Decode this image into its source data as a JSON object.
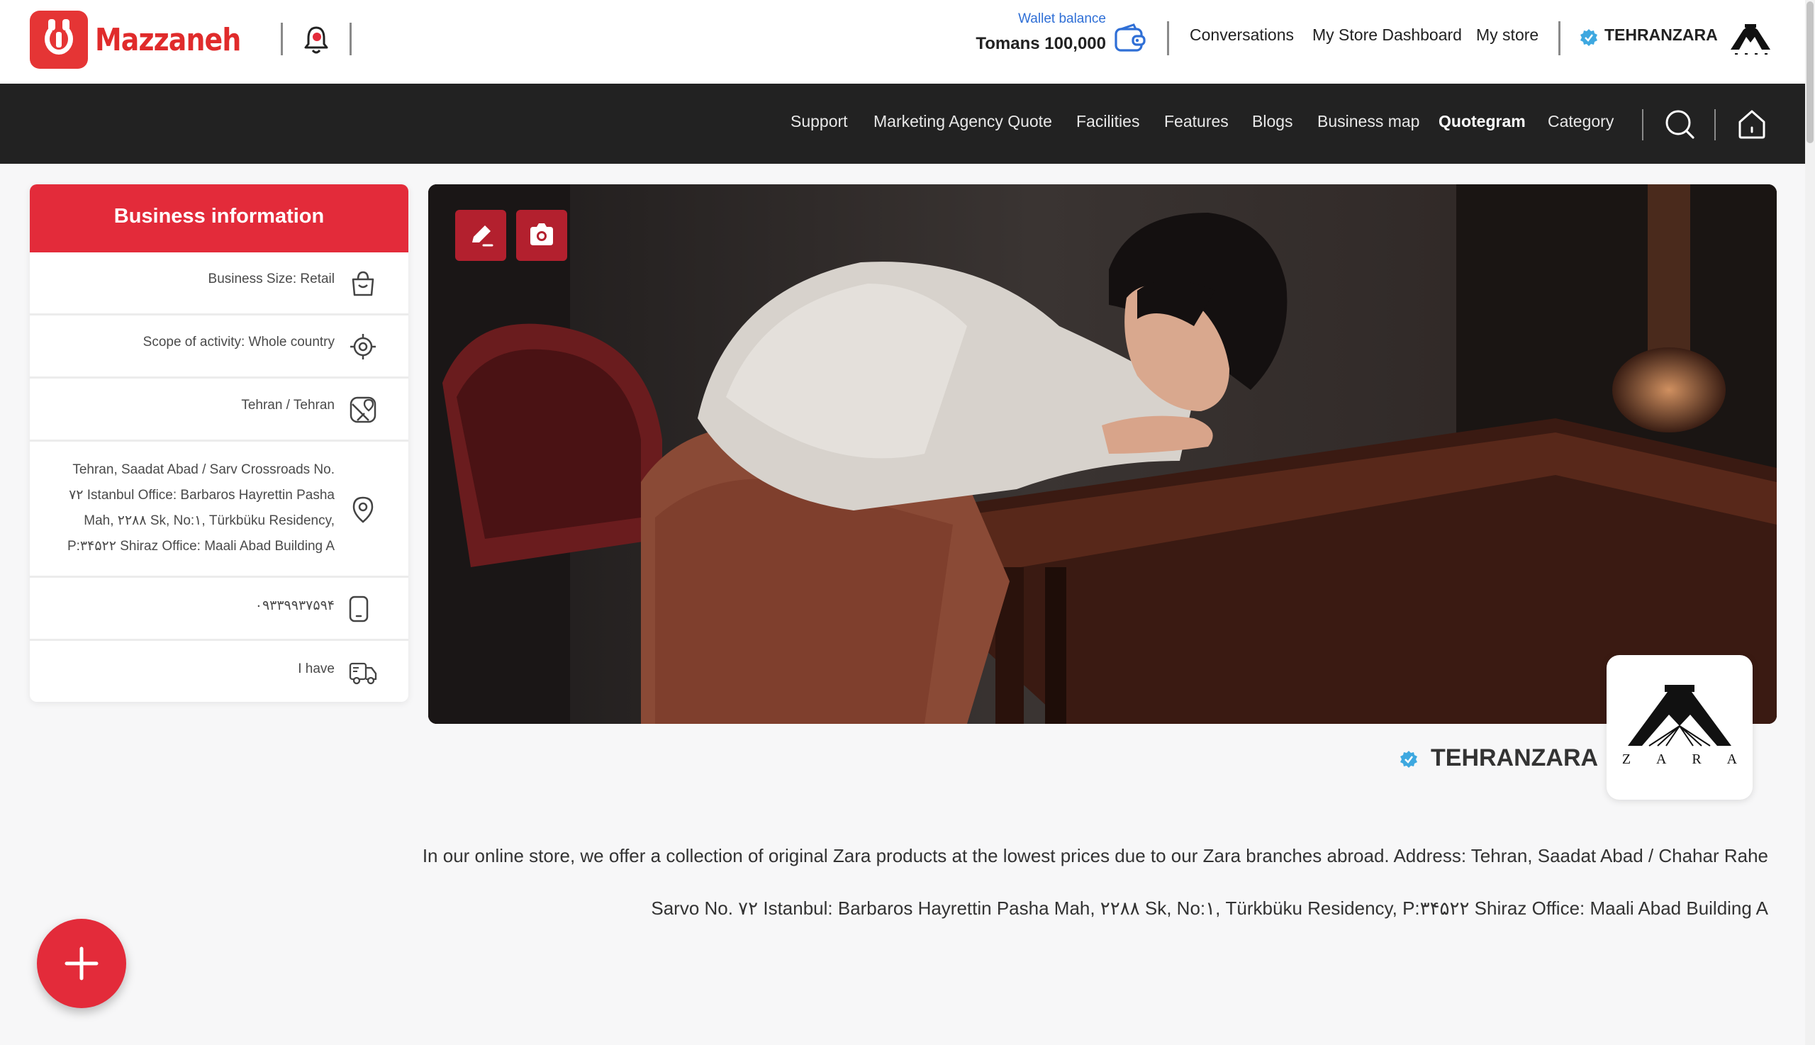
{
  "header": {
    "logo_text": "Mazzaneh",
    "wallet": {
      "label": "Wallet balance",
      "amount": "Tomans 100,000"
    },
    "links": [
      "Conversations",
      "My Store Dashboard",
      "My store"
    ],
    "user_name": "TEHRANZARA"
  },
  "nav": {
    "items": [
      "Support",
      "Marketing Agency Quote",
      "Facilities",
      "Features",
      "Blogs",
      "Business map",
      "Quotegram",
      "Category"
    ],
    "active": "Quotegram"
  },
  "business_info": {
    "title": "Business information",
    "rows": [
      {
        "text": "Business Size: Retail",
        "icon": "shopping-bag-icon"
      },
      {
        "text": "Scope of activity: Whole country",
        "icon": "target-icon"
      },
      {
        "text": "Tehran / Tehran",
        "icon": "map-icon"
      },
      {
        "lines": [
          "Tehran, Saadat Abad / Sarv Crossroads No.",
          "۷۲ Istanbul Office: Barbaros Hayrettin Pasha",
          "Mah, ۲۲۸۸ Sk, No:۱, Türkbüku Residency,",
          "P:۳۴۵۲۲ Shiraz Office: Maali Abad Building A"
        ],
        "icon": "location-pin-icon"
      },
      {
        "text": "۰۹۳۳۹۹۳۷۵۹۴",
        "icon": "mobile-phone-icon"
      },
      {
        "text": "I have",
        "icon": "delivery-truck-icon"
      }
    ]
  },
  "store": {
    "name": "TEHRANZARA",
    "logo_letters": "Z A R A",
    "description_lines": [
      "In our online store, we offer a collection of original Zara products at the lowest prices due to our Zara branches abroad. Address: Tehran, Saadat Abad / Chahar Rahe",
      "Sarvo No. ۷۲ Istanbul: Barbaros Hayrettin Pasha Mah, ۲۲۸۸ Sk, No:۱, Türkbüku Residency, P:۳۴۵۲۲ Shiraz Office: Maali Abad Building A"
    ]
  },
  "colors": {
    "brand_red": "#e32b3a",
    "nav_bg": "#222222",
    "link_blue": "#2f6fd6",
    "verified_blue": "#3ea8e0"
  }
}
